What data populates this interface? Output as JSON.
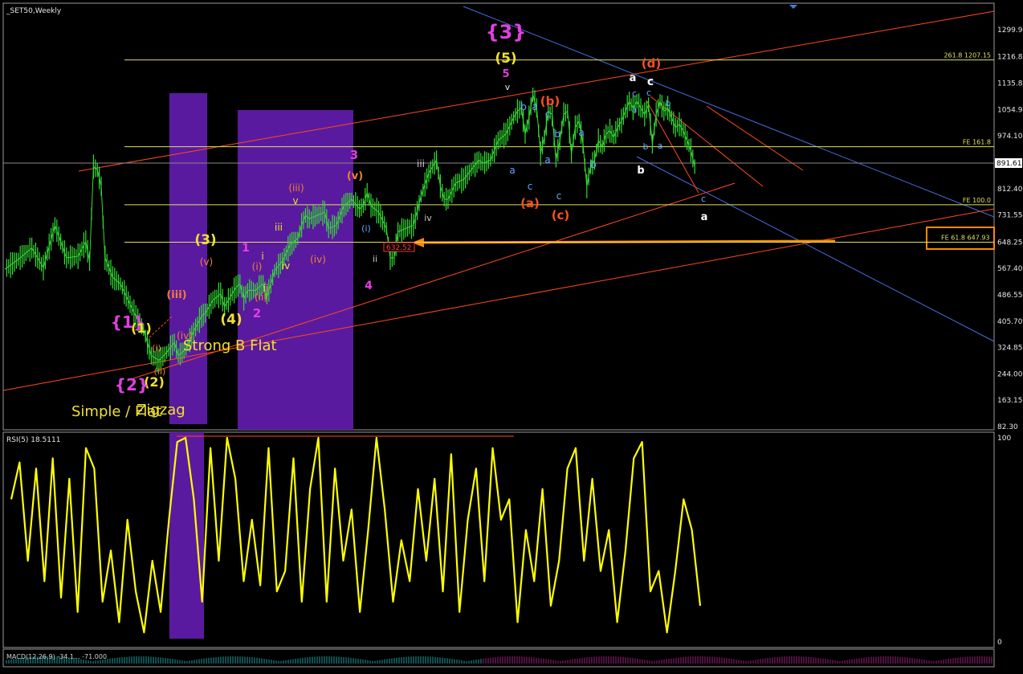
{
  "chart_data": {
    "type": "line",
    "symbol_label": "_SET50,Weekly",
    "price_axis": {
      "min": 82.3,
      "max": 1299.95,
      "ticks": [
        "1299.95",
        "1216.80",
        "1135.80",
        "1054.95",
        "974.10",
        "891.61",
        "812.40",
        "731.55",
        "648.25",
        "567.40",
        "486.55",
        "405.70",
        "324.85",
        "244.00",
        "163.15",
        "82.30"
      ]
    },
    "current_price": "891.61",
    "price_series": {
      "name": "SET50 weekly close",
      "start": 565,
      "points": [
        [
          0,
          565
        ],
        [
          8,
          600
        ],
        [
          14,
          630
        ],
        [
          20,
          570
        ],
        [
          26,
          700
        ],
        [
          32,
          600
        ],
        [
          38,
          605
        ],
        [
          42,
          650
        ],
        [
          44,
          590
        ],
        [
          46,
          880
        ],
        [
          48,
          870
        ],
        [
          50,
          820
        ],
        [
          52,
          600
        ],
        [
          56,
          540
        ],
        [
          60,
          520
        ],
        [
          64,
          470
        ],
        [
          68,
          420
        ],
        [
          72,
          380
        ],
        [
          76,
          300
        ],
        [
          80,
          285
        ],
        [
          84,
          310
        ],
        [
          88,
          340
        ],
        [
          90,
          300
        ],
        [
          94,
          320
        ],
        [
          98,
          375
        ],
        [
          102,
          420
        ],
        [
          104,
          430
        ],
        [
          108,
          470
        ],
        [
          112,
          490
        ],
        [
          114,
          450
        ],
        [
          116,
          470
        ],
        [
          120,
          510
        ],
        [
          122,
          520
        ],
        [
          124,
          475
        ],
        [
          126,
          500
        ],
        [
          130,
          500
        ],
        [
          134,
          520
        ],
        [
          136,
          480
        ],
        [
          140,
          560
        ],
        [
          144,
          590
        ],
        [
          148,
          640
        ],
        [
          152,
          660
        ],
        [
          154,
          700
        ],
        [
          156,
          730
        ],
        [
          158,
          720
        ],
        [
          162,
          730
        ],
        [
          166,
          740
        ],
        [
          168,
          690
        ],
        [
          172,
          700
        ],
        [
          176,
          760
        ],
        [
          180,
          780
        ],
        [
          184,
          750
        ],
        [
          186,
          760
        ],
        [
          188,
          800
        ],
        [
          190,
          760
        ],
        [
          194,
          740
        ],
        [
          198,
          690
        ],
        [
          200,
          600
        ],
        [
          202,
          600
        ],
        [
          204,
          680
        ],
        [
          208,
          690
        ],
        [
          212,
          700
        ],
        [
          216,
          790
        ],
        [
          220,
          860
        ],
        [
          222,
          880
        ],
        [
          224,
          900
        ],
        [
          226,
          820
        ],
        [
          228,
          780
        ],
        [
          230,
          780
        ],
        [
          234,
          830
        ],
        [
          238,
          840
        ],
        [
          242,
          870
        ],
        [
          246,
          900
        ],
        [
          248,
          890
        ],
        [
          252,
          900
        ],
        [
          256,
          960
        ],
        [
          260,
          980
        ],
        [
          264,
          1030
        ],
        [
          266,
          1050
        ],
        [
          268,
          1060
        ],
        [
          270,
          980
        ],
        [
          272,
          1030
        ],
        [
          274,
          1100
        ],
        [
          276,
          1060
        ],
        [
          278,
          920
        ],
        [
          280,
          970
        ],
        [
          282,
          1050
        ],
        [
          284,
          1040
        ],
        [
          286,
          900
        ],
        [
          288,
          960
        ],
        [
          290,
          1040
        ],
        [
          292,
          1050
        ],
        [
          294,
          920
        ],
        [
          296,
          1000
        ],
        [
          298,
          1020
        ],
        [
          300,
          950
        ],
        [
          302,
          820
        ],
        [
          304,
          880
        ],
        [
          306,
          900
        ],
        [
          308,
          960
        ],
        [
          310,
          940
        ],
        [
          312,
          980
        ],
        [
          314,
          990
        ],
        [
          316,
          970
        ],
        [
          318,
          1000
        ],
        [
          320,
          1020
        ],
        [
          322,
          1050
        ],
        [
          324,
          1080
        ],
        [
          326,
          1060
        ],
        [
          328,
          1080
        ],
        [
          330,
          1060
        ],
        [
          332,
          1040
        ],
        [
          334,
          1070
        ],
        [
          336,
          950
        ],
        [
          338,
          1040
        ],
        [
          340,
          1080
        ],
        [
          342,
          1050
        ],
        [
          344,
          1060
        ],
        [
          346,
          1030
        ],
        [
          348,
          1000
        ],
        [
          350,
          1010
        ],
        [
          352,
          990
        ],
        [
          354,
          960
        ],
        [
          356,
          930
        ],
        [
          358,
          880
        ]
      ]
    },
    "horizontal_levels": [
      {
        "value": 1207.15,
        "label": "261.8 1207.15"
      },
      {
        "value": 941,
        "label": "FE 161.8"
      },
      {
        "value": 763,
        "label": "FE 100.0"
      },
      {
        "value": 647.93,
        "label": "FE 61.8 647.93"
      }
    ],
    "marker_label": "632.52",
    "wave_labels": [
      {
        "t": "{3}",
        "c": "#e040e0"
      },
      {
        "t": "(5)",
        "c": "#f0e030"
      },
      {
        "t": "5",
        "c": "#e040e0"
      },
      {
        "t": "v",
        "c": "#e0e0e0"
      },
      {
        "t": "(d)",
        "c": "#ff5020"
      },
      {
        "t": "a",
        "c": "#ffffff"
      },
      {
        "t": "c",
        "c": "#ffffff"
      },
      {
        "t": "b",
        "c": "#ffffff"
      },
      {
        "t": "a",
        "c": "#ffffff"
      },
      {
        "t": "(b)",
        "c": "#ff5020"
      },
      {
        "t": "(a)",
        "c": "#ff5020"
      },
      {
        "t": "(c)",
        "c": "#ff5020"
      },
      {
        "t": "b",
        "c": "#5fa8ff"
      },
      {
        "t": "a",
        "c": "#5fa8ff"
      },
      {
        "t": "c",
        "c": "#5fa8ff"
      },
      {
        "t": "a",
        "c": "#5fa8ff"
      },
      {
        "t": "c",
        "c": "#5fa8ff"
      },
      {
        "t": "b",
        "c": "#5fa8ff"
      },
      {
        "t": "a",
        "c": "#5fa8ff"
      },
      {
        "t": "c",
        "c": "#5fa8ff"
      },
      {
        "t": "a",
        "c": "#5fa8ff"
      },
      {
        "t": "b",
        "c": "#5fa8ff"
      },
      {
        "t": "c",
        "c": "#5fa8ff"
      },
      {
        "t": "b",
        "c": "#5fa8ff"
      },
      {
        "t": "a",
        "c": "#5fa8ff"
      },
      {
        "t": "c",
        "c": "#5fa8ff"
      },
      {
        "t": "a",
        "c": "#5fa8ff"
      },
      {
        "t": "b",
        "c": "#5fa8ff"
      },
      {
        "t": "c",
        "c": "#5fa8ff"
      },
      {
        "t": "3",
        "c": "#e040e0"
      },
      {
        "t": "(v)",
        "c": "#f08030"
      },
      {
        "t": "iii",
        "c": "#c8c8c8"
      },
      {
        "t": "iv",
        "c": "#c8c8c8"
      },
      {
        "t": "(iii)",
        "c": "#f08030"
      },
      {
        "t": "v",
        "c": "#f0e030"
      },
      {
        "t": "iii",
        "c": "#f0e030"
      },
      {
        "t": "(iv)",
        "c": "#f08030"
      },
      {
        "t": "iv",
        "c": "#f0e030"
      },
      {
        "t": "(i)",
        "c": "#5fa8ff"
      },
      {
        "t": "ii",
        "c": "#c8c8c8"
      },
      {
        "t": "4",
        "c": "#e040e0"
      },
      {
        "t": "(3)",
        "c": "#f0e030"
      },
      {
        "t": "(v)",
        "c": "#f08030"
      },
      {
        "t": "1",
        "c": "#e040e0"
      },
      {
        "t": "i",
        "c": "#f0e030"
      },
      {
        "t": "(i)",
        "c": "#f08030"
      },
      {
        "t": "ii",
        "c": "#f0e030"
      },
      {
        "t": "(ii)",
        "c": "#f08030"
      },
      {
        "t": "2",
        "c": "#e040e0"
      },
      {
        "t": "(iii)",
        "c": "#f08030"
      },
      {
        "t": "(iv)",
        "c": "#f08030"
      },
      {
        "t": "(4)",
        "c": "#f0e030"
      },
      {
        "t": "{1}",
        "c": "#e040e0"
      },
      {
        "t": "(1)",
        "c": "#f0e030"
      },
      {
        "t": "(i)",
        "c": "#f08030"
      },
      {
        "t": "(ii)",
        "c": "#f08030"
      },
      {
        "t": "(2)",
        "c": "#f0e030"
      },
      {
        "t": "{2}",
        "c": "#e040e0"
      }
    ],
    "annotations": [
      "Strong B Flat",
      "Simple / Flat",
      "Zigzag"
    ],
    "rsi": {
      "label": "RSI(5) 18.5111",
      "ymin": 0,
      "ymax": 100,
      "ticks": [
        "100",
        "0"
      ],
      "values": [
        70,
        88,
        40,
        85,
        30,
        90,
        22,
        80,
        15,
        95,
        85,
        20,
        45,
        10,
        60,
        25,
        5,
        40,
        15,
        60,
        98,
        100,
        70,
        20,
        95,
        40,
        100,
        80,
        30,
        60,
        28,
        95,
        25,
        35,
        90,
        20,
        75,
        100,
        20,
        85,
        40,
        65,
        15,
        55,
        100,
        65,
        20,
        50,
        30,
        75,
        40,
        80,
        25,
        92,
        15,
        60,
        85,
        30,
        95,
        60,
        70,
        10,
        55,
        30,
        75,
        18,
        40,
        85,
        95,
        40,
        80,
        35,
        55,
        10,
        45,
        90,
        98,
        25,
        35,
        5,
        35,
        70,
        55,
        18
      ]
    },
    "macd_label": "MACD(12,26,9) -34.1... -71.000",
    "colors": {
      "price": "#33dd33",
      "rsi": "#ffff00",
      "level": "#e0e060",
      "channel": "#ff4a1a",
      "blue": "#4a6ae0",
      "purple": "#5a1aa0",
      "marker": "#ff8a00"
    }
  }
}
